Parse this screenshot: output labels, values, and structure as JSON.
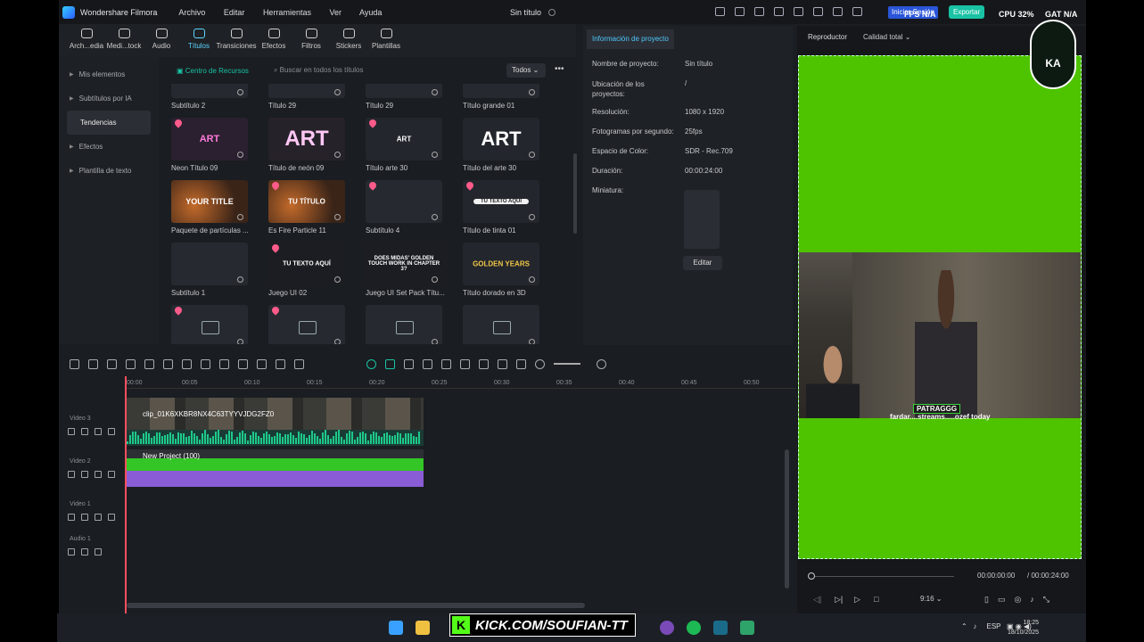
{
  "app": {
    "name": "Wondershare Filmora",
    "doc_title": "Sin título"
  },
  "menu": [
    "Archivo",
    "Editar",
    "Herramientas",
    "Ver",
    "Ayuda"
  ],
  "titlebar": {
    "login": "Iniciar Sesión",
    "export": "Exportar",
    "fps": "FPS N/A",
    "cpu": "CPU 32%",
    "gat": "GAT N/A"
  },
  "toolbar": [
    {
      "label": "Arch...edia"
    },
    {
      "label": "Medi...tock"
    },
    {
      "label": "Audio"
    },
    {
      "label": "Títulos"
    },
    {
      "label": "Transiciones"
    },
    {
      "label": "Efectos"
    },
    {
      "label": "Filtros"
    },
    {
      "label": "Stickers"
    },
    {
      "label": "Plantillas"
    }
  ],
  "leftnav": [
    {
      "label": "Mis elementos"
    },
    {
      "label": "Subtítulos por IA"
    },
    {
      "label": "Tendencias"
    },
    {
      "label": "Efectos"
    },
    {
      "label": "Plantilla de texto"
    }
  ],
  "resources": {
    "center": "Centro de Recursos",
    "search_placeholder": "Buscar en todos los títulos",
    "filter": "Todos"
  },
  "cards": [
    {
      "label": "Subtítulo 2",
      "thumb": ""
    },
    {
      "label": "Título 29",
      "thumb": ""
    },
    {
      "label": "Título 29",
      "thumb": ""
    },
    {
      "label": "Título grande 01",
      "thumb": ""
    },
    {
      "label": "Neon Título 09",
      "thumb": "ART"
    },
    {
      "label": "Título de neón 09",
      "thumb": "ART"
    },
    {
      "label": "Título arte 30",
      "thumb": "ART"
    },
    {
      "label": "Título del arte 30",
      "thumb": "ART"
    },
    {
      "label": "Paquete de partículas ...",
      "thumb": "YOUR TITLE"
    },
    {
      "label": "Es Fire Particle 11",
      "thumb": "TU TÍTULO"
    },
    {
      "label": "Subtítulo 4",
      "thumb": ""
    },
    {
      "label": "Título de tinta 01",
      "thumb": "TU TEXTO AQUÍ"
    },
    {
      "label": "Subtítulo 1",
      "thumb": ""
    },
    {
      "label": "Juego UI 02",
      "thumb": "TU TEXTO AQUÍ"
    },
    {
      "label": "Juego UI Set Pack Títu...",
      "thumb": "DOES MIDAS' GOLDEN TOUCH WORK IN CHAPTER 3?"
    },
    {
      "label": "Título dorado en 3D",
      "thumb": "GOLDEN YEARS"
    },
    {
      "label": "",
      "thumb": ""
    },
    {
      "label": "",
      "thumb": ""
    },
    {
      "label": "",
      "thumb": ""
    },
    {
      "label": "",
      "thumb": ""
    }
  ],
  "info": {
    "tab": "Información de proyecto",
    "rows": [
      {
        "k": "Nombre de proyecto:",
        "v": "Sin título"
      },
      {
        "k": "Ubicación de los proyectos:",
        "v": "/"
      },
      {
        "k": "Resolución:",
        "v": "1080 x 1920"
      },
      {
        "k": "Fotogramas por segundo:",
        "v": "25fps"
      },
      {
        "k": "Espacio de Color:",
        "v": "SDR - Rec.709"
      },
      {
        "k": "Duración:",
        "v": "00:00:24:00"
      },
      {
        "k": "Miniatura:",
        "v": ""
      }
    ],
    "edit": "Editar"
  },
  "player": {
    "title": "Reproductor",
    "quality": "Calidad total",
    "caption": "fardar....streams.....ozef today",
    "tag": "PATRAGGG",
    "time_current": "00:00:00:00",
    "time_total": "/ 00:00:24:00",
    "ratio": "9:16",
    "badge": "KA"
  },
  "timeline": {
    "ticks": [
      "00:00",
      "00:05",
      "00:10",
      "00:15",
      "00:20",
      "00:25",
      "00:30",
      "00:35",
      "00:40",
      "00:45",
      "00:50"
    ],
    "tracks": [
      {
        "label": "Video 3"
      },
      {
        "label": "Video 2"
      },
      {
        "label": "Video 1"
      },
      {
        "label": "Audio 1"
      }
    ],
    "clip_video": "clip_01K6XKBR8NX4C63TYYVJDG2FZ0",
    "clip_project": "New Project (100)"
  },
  "taskbar": {
    "kick": "KICK.COM/SOUFIAN-TT",
    "lang": "ESP",
    "time": "18:25",
    "date": "18/10/2025"
  },
  "colors": {
    "accent": "#19c3a4",
    "playhead": "#ff4f5e",
    "green_screen": "#4ec300"
  }
}
